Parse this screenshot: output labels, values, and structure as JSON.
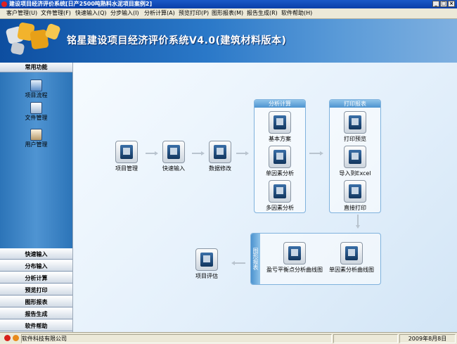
{
  "window": {
    "title": "建设项目经济评价系统[日产2500吨熟料水泥项目案例2]",
    "min_label": "_",
    "max_label": "□",
    "close_label": "×"
  },
  "menu": [
    "客户管理(U)",
    "文件管理(F)",
    "快速输入(Q)",
    "分步输入(I)",
    "分析计算(A)",
    "预览打印(P)",
    "图形报表(M)",
    "报告生成(R)",
    "软件帮助(H)"
  ],
  "banner": {
    "title": "铭星建设项目经济评价系统V4.0(建筑材料版本)"
  },
  "sidebar": {
    "header": "常用功能",
    "icon_items": [
      {
        "label": "项目流程",
        "icon": "flowchart-icon"
      },
      {
        "label": "文件管理",
        "icon": "file-manager-icon"
      },
      {
        "label": "用户管理",
        "icon": "user-manager-icon"
      }
    ],
    "buttons": [
      "快速输入",
      "分布输入",
      "分析计算",
      "预览打印",
      "图形报表",
      "报告生成",
      "软件帮助"
    ]
  },
  "flow": {
    "nodes": {
      "project_management": "项目管理",
      "quick_input": "快速输入",
      "data_modify": "数据修改",
      "project_evaluation": "项目评估"
    },
    "analysis_group": {
      "title": "分析计算",
      "items": [
        "基本方案",
        "单因素分析",
        "多因素分析"
      ]
    },
    "print_group": {
      "title": "打印报表",
      "items": [
        "打印预览",
        "导入到Excel",
        "直接打印"
      ]
    },
    "chart_group": {
      "title": "图形报表",
      "items": [
        "盈亏平衡点分析曲线图",
        "单因素分析曲线图"
      ]
    }
  },
  "status": {
    "company": "软件科技有限公司",
    "date": "2009年8月8日"
  },
  "colors": {
    "titlebar": "#1a59c8",
    "banner_start": "#0d4ea0",
    "sidebar_panel": "#2c74b8",
    "group_header": "#4c93cf"
  }
}
